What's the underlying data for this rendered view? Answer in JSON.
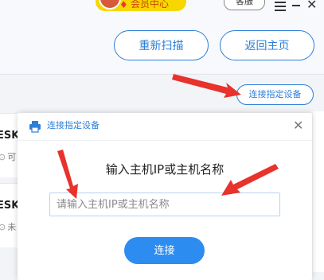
{
  "header": {
    "vip_label": "会员中心",
    "service_label": "客服",
    "rescan_label": "重新扫描",
    "home_label": "返回主页"
  },
  "toolbar": {
    "connect_device_label": "连接指定设备"
  },
  "background_rows": [
    {
      "name": "ESK",
      "status": "可"
    },
    {
      "name": "ESK",
      "status": "未"
    }
  ],
  "dialog": {
    "title": "连接指定设备",
    "heading": "输入主机IP或主机名称",
    "input_placeholder": "请输入主机IP或主机名称",
    "input_value": "",
    "connect_label": "连接"
  },
  "colors": {
    "accent": "#2e7fd8",
    "primary_button": "#2d8cf0",
    "annotation_arrow": "#e8322c",
    "vip_pill": "#f6d800"
  }
}
